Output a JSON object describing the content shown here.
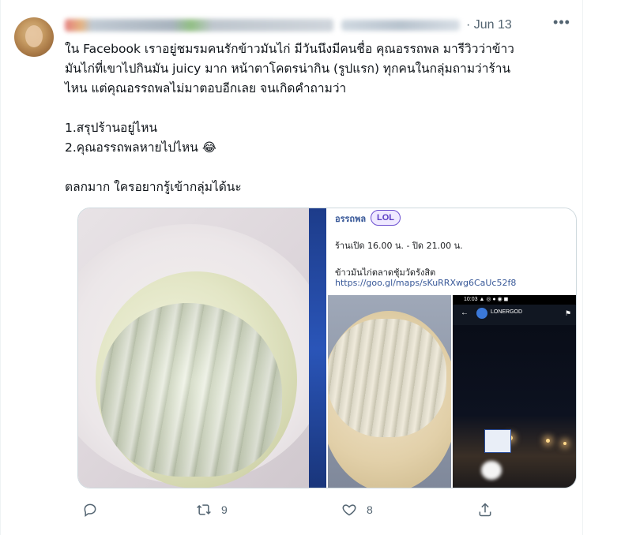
{
  "tweet": {
    "time": "· Jun 13",
    "more_icon": "more-horizontal-icon",
    "lines": [
      "ใน Facebook เราอยู่ชมรมคนรักข้าวมันไก่ มีวันนึงมีคนชื่อ คุณอรรถพล มารีวิวว่าข้าว",
      "มันไก่ที่เขาไปกินมัน juicy มาก หน้าตาโคตรน่ากิน (รูปแรก) ทุกคนในกลุ่มถามว่าร้าน",
      "ไหน แต่คุณอรรถพลไม่มาตอบอีกเลย จนเกิดคำถามว่า",
      "",
      "1.สรุปร้านอยู่ไหน",
      "2.คุณอรรถพลหายไปไหน 😂",
      "",
      "ตลกมาก ใครอยากรู้เข้ากลุ่มได้นะ"
    ]
  },
  "media": {
    "panel_name": "อรรถพล",
    "lol_badge": "LOL",
    "hours": "ร้านเปิด 16.00 น. - ปิด 21.00 น.",
    "place": "ข้าวมันไก่ตลาดชุ้มวัดรังสิต",
    "link": "https://goo.gl/maps/sKuRRXwg6CaUc52f8",
    "phone_status": "10:03 ▲ ◎ ● ◉ ◼",
    "phone_title": "LONERGOD"
  },
  "actions": {
    "reply_icon": "reply-icon",
    "retweet_icon": "retweet-icon",
    "retweet_count": "9",
    "like_icon": "heart-icon",
    "like_count": "8",
    "share_icon": "share-icon"
  },
  "colors": {
    "text": "#0f1419",
    "secondary": "#536471",
    "border": "#cfd9de",
    "link": "#385898"
  }
}
